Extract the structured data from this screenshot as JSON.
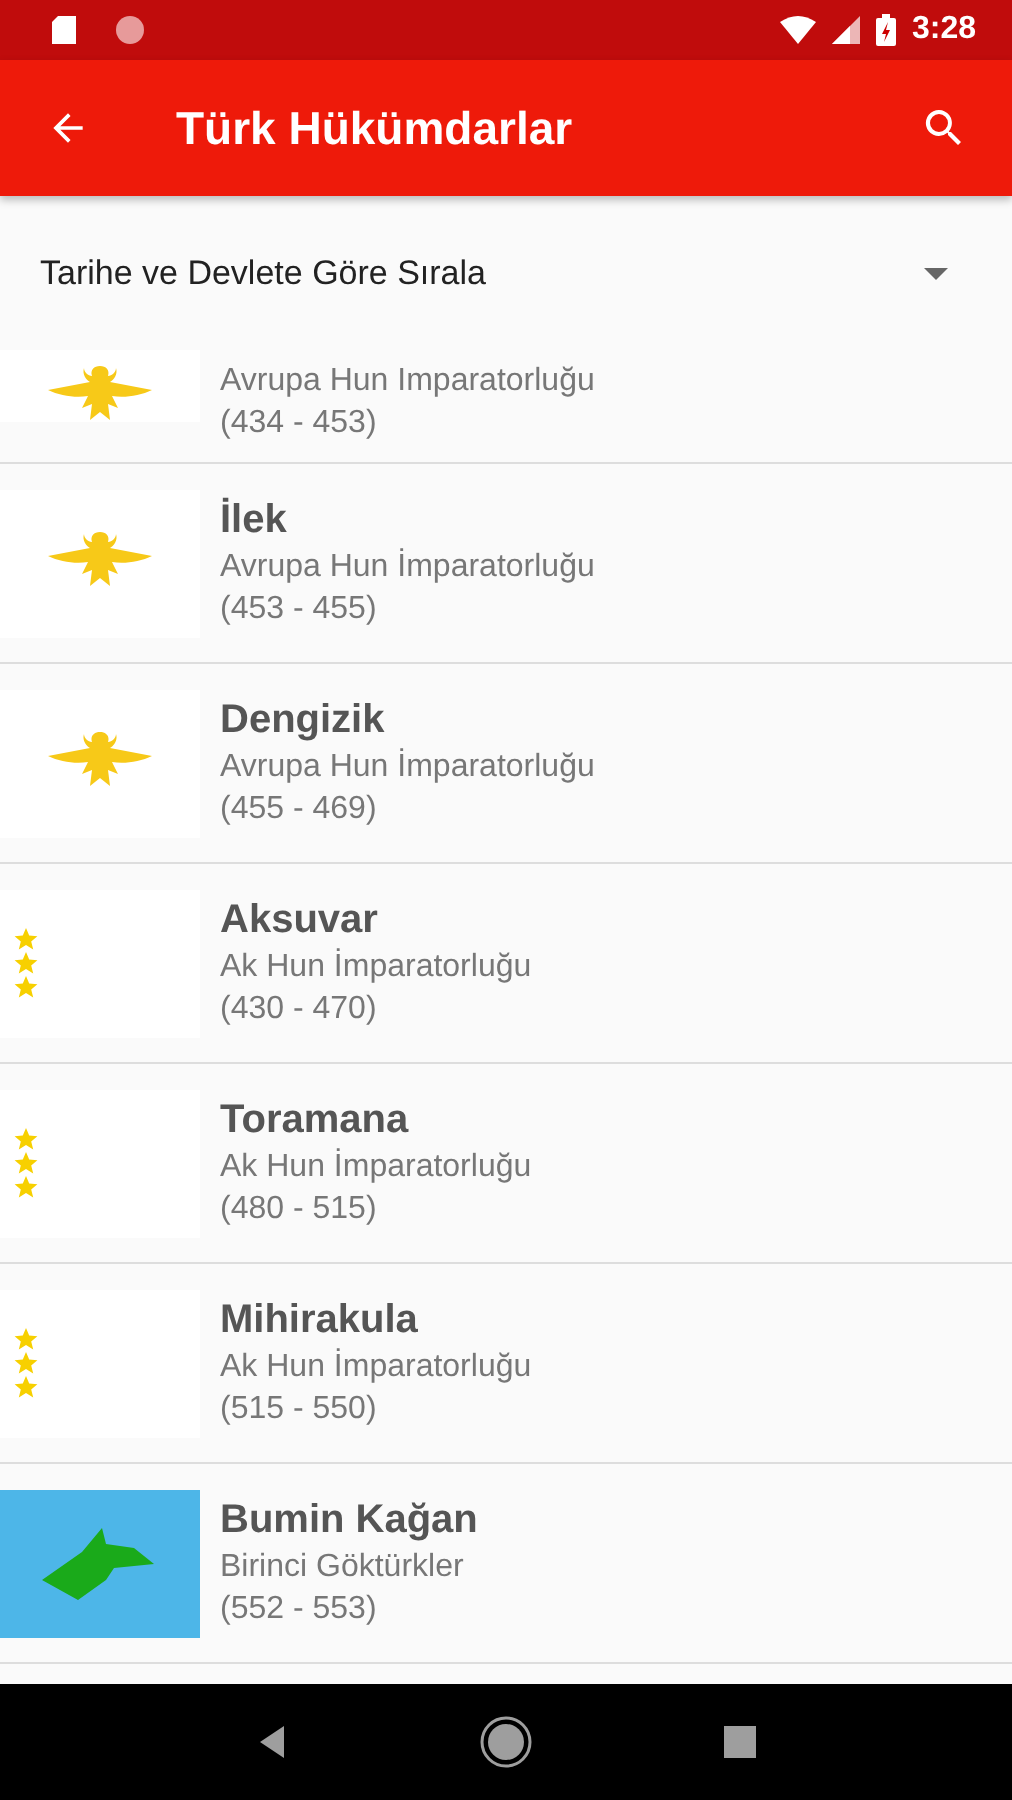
{
  "status_bar": {
    "time": "3:28"
  },
  "app_bar": {
    "title": "Türk Hükümdarlar"
  },
  "sort": {
    "label": "Tarihe ve Devlete Göre Sırala"
  },
  "rulers": [
    {
      "partial": true,
      "state": "Avrupa Hun Imparatorluğu",
      "years": "(434 - 453)",
      "flag": {
        "kind": "eagle"
      }
    },
    {
      "partial": false,
      "name": "İlek",
      "state": "Avrupa Hun İmparatorluğu",
      "years": "(453 - 455)",
      "flag": {
        "kind": "eagle"
      }
    },
    {
      "partial": false,
      "name": "Dengizik",
      "state": "Avrupa Hun İmparatorluğu",
      "years": "(455 - 469)",
      "flag": {
        "kind": "eagle"
      }
    },
    {
      "partial": false,
      "name": "Aksuvar",
      "state": "Ak Hun İmparatorluğu",
      "years": "(430 - 470)",
      "flag": {
        "kind": "stars"
      }
    },
    {
      "partial": false,
      "name": "Toramana",
      "state": "Ak Hun İmparatorluğu",
      "years": "(480 - 515)",
      "flag": {
        "kind": "stars"
      }
    },
    {
      "partial": false,
      "name": "Mihirakula",
      "state": "Ak Hun İmparatorluğu",
      "years": "(515 - 550)",
      "flag": {
        "kind": "stars"
      }
    },
    {
      "partial": false,
      "name": "Bumin Kağan",
      "state": "Birinci Göktürkler",
      "years": "(552 - 553)",
      "flag": {
        "kind": "wolf"
      }
    }
  ]
}
